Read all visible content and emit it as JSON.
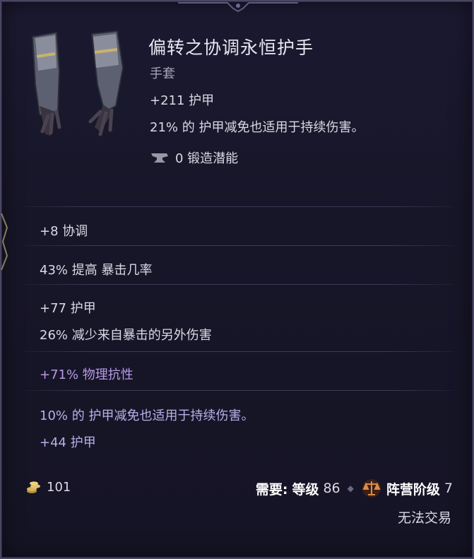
{
  "item": {
    "name": "偏转之协调永恒护手",
    "type": "手套",
    "base_stats": [
      "+211 护甲",
      "21% 的 护甲减免也适用于持续伤害。"
    ],
    "forge_potential": "0 锻造潜能",
    "icon": "gauntlets-icon"
  },
  "affixes": [
    {
      "lines": [
        "+8 协调"
      ]
    },
    {
      "lines": [
        "43% 提高 暴击几率"
      ]
    },
    {
      "lines": [
        "+77 护甲",
        "26% 减少来自暴击的另外伤害"
      ]
    },
    {
      "lines": [
        "+71% 物理抗性"
      ]
    },
    {
      "lines": [
        "10% 的 护甲减免也适用于持续伤害。",
        "+44 护甲"
      ]
    }
  ],
  "footer": {
    "gold": "101",
    "requires_label": "需要:",
    "level_label": "等级",
    "level_value": "86",
    "faction_label": "阵营阶级",
    "faction_value": "7",
    "untradeable": "无法交易"
  },
  "colors": {
    "text": "#dcd9e4",
    "title": "#e9e6f2",
    "purple_affix": "#b79ae6",
    "lavender_affix": "#b6b0ea",
    "background": "#171628",
    "gold": "#d9b45a",
    "faction": "#d77a3a"
  }
}
